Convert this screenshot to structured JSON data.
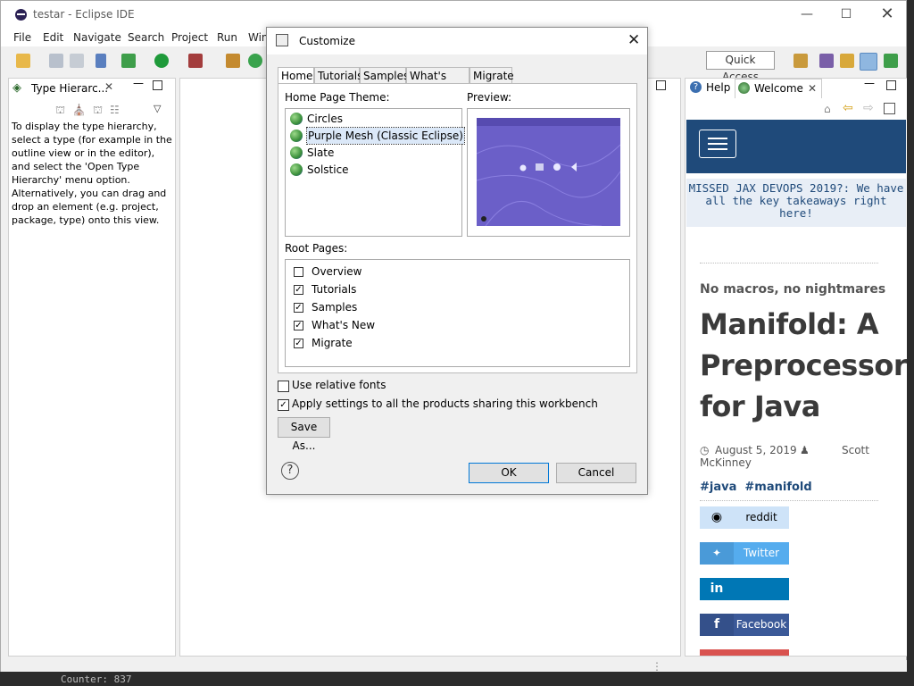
{
  "window": {
    "title": "testar - Eclipse IDE"
  },
  "menu": {
    "items": [
      "File",
      "Edit",
      "Navigate",
      "Search",
      "Project",
      "Run",
      "Win"
    ]
  },
  "toolbar": {
    "quick_access": "Quick Access"
  },
  "left_view": {
    "tab_label": "Type Hierarc...",
    "message": "To display the type hierarchy, select a type (for example in the outline view or in the editor), and select the 'Open Type Hierarchy' menu option. Alternatively, you can drag and drop an element (e.g. project, package, type) onto this view."
  },
  "right_view": {
    "tabs": [
      "Help",
      "Welcome"
    ],
    "promo": "MISSED JAX DEVOPS 2019?: We have all the key takeaways right here!",
    "kicker": "No macros, no nightmares",
    "headline": "Manifold: A Preprocessor for Java",
    "date": "August 5, 2019",
    "author": "Scott McKinney",
    "tags": "#java  #manifold",
    "share": [
      {
        "label": "reddit",
        "icon": "reddit-icon",
        "color": "#cee3f8",
        "text_color": "#000000"
      },
      {
        "label": "Twitter",
        "icon": "twitter-icon",
        "color": "#55acee",
        "text_color": "#ffffff"
      },
      {
        "label": "",
        "icon": "linkedin-icon",
        "color": "#0077b5",
        "text_color": "#ffffff"
      },
      {
        "label": "Facebook",
        "icon": "facebook-icon",
        "color": "#3b5998",
        "text_color": "#ffffff"
      }
    ]
  },
  "console": {
    "text": "Counter: 837"
  },
  "dialog": {
    "title": "Customize",
    "tabs": [
      "Home",
      "Tutorials",
      "Samples",
      "What's New",
      "Migrate"
    ],
    "selected_tab": "Home",
    "theme_label": "Home Page Theme:",
    "preview_label": "Preview:",
    "themes": [
      "Circles",
      "Purple Mesh (Classic Eclipse)",
      "Slate",
      "Solstice"
    ],
    "selected_theme": "Purple Mesh (Classic Eclipse)",
    "root_pages_label": "Root Pages:",
    "root_pages": [
      {
        "label": "Overview",
        "checked": false
      },
      {
        "label": "Tutorials",
        "checked": true
      },
      {
        "label": "Samples",
        "checked": true
      },
      {
        "label": "What's New",
        "checked": true
      },
      {
        "label": "Migrate",
        "checked": true
      }
    ],
    "use_relative_fonts": {
      "label": "Use relative fonts",
      "checked": false
    },
    "apply_settings": {
      "label": "Apply settings to all the products sharing this workbench",
      "checked": true
    },
    "save_as": "Save As...",
    "ok": "OK",
    "cancel": "Cancel"
  }
}
